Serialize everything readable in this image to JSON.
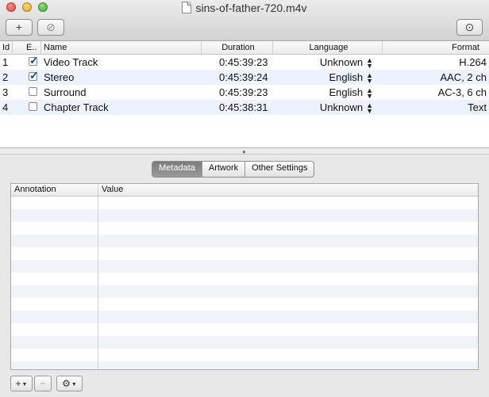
{
  "window": {
    "title": "sins-of-father-720.m4v",
    "icons": {
      "file": "document-icon"
    }
  },
  "toolbar": {
    "add_symbol": "+",
    "remove_symbol": "⊘",
    "inspect_symbol": "⊙"
  },
  "tracks_table": {
    "columns": {
      "id": "Id",
      "enabled": "E..",
      "name": "Name",
      "duration": "Duration",
      "language": "Language",
      "format": "Format"
    },
    "rows": [
      {
        "id": "1",
        "enabled": true,
        "name": "Video Track",
        "duration": "0:45:39:23",
        "language": "Unknown",
        "format": "H.264"
      },
      {
        "id": "2",
        "enabled": true,
        "name": "Stereo",
        "duration": "0:45:39:24",
        "language": "English",
        "format": "AAC, 2 ch"
      },
      {
        "id": "3",
        "enabled": false,
        "name": "Surround",
        "duration": "0:45:39:23",
        "language": "English",
        "format": "AC-3, 6 ch"
      },
      {
        "id": "4",
        "enabled": false,
        "name": "Chapter Track",
        "duration": "0:45:38:31",
        "language": "Unknown",
        "format": "Text"
      }
    ]
  },
  "tabs": [
    {
      "label": "Metadata",
      "active": true
    },
    {
      "label": "Artwork",
      "active": false
    },
    {
      "label": "Other Settings",
      "active": false
    }
  ],
  "metadata_table": {
    "columns": {
      "annotation": "Annotation",
      "value": "Value"
    },
    "rows": []
  },
  "bottom_bar": {
    "add_symbol": "+",
    "remove_symbol": "−",
    "gear_symbol": "⚙"
  },
  "colors": {
    "row_alt": "#edf3fe",
    "check": "#1d3f8f",
    "active_tab": "#8a8a8a"
  }
}
